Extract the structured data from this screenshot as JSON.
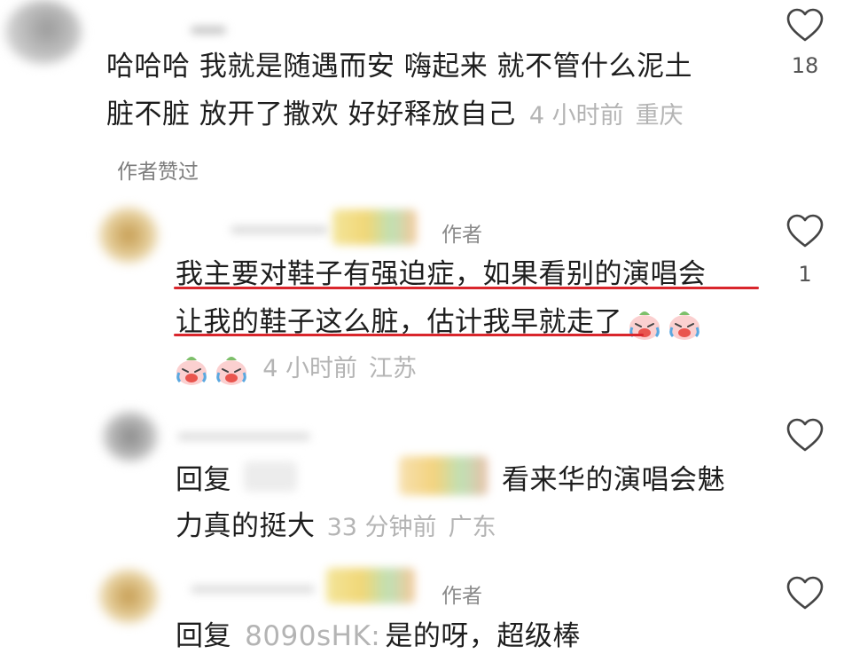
{
  "comments": [
    {
      "text_line1": "哈哈哈 我就是随遇而安 嗨起来 就不管什么泥土",
      "text_line2": "脏不脏 放开了撒欢 好好释放自己",
      "time": "4 小时前",
      "location": "重庆",
      "likes": "18",
      "liked_by": "作者赞过"
    },
    {
      "author_tag": "作者",
      "text_line1": "我主要对鞋子有强迫症，如果看别的演唱会",
      "text_line2": "让我的鞋子这么脏，估计我早就走了",
      "time": "4 小时前",
      "location": "江苏",
      "likes": "1",
      "highlight_color": "#d9262c"
    },
    {
      "reply_prefix": "回复",
      "text_line1": "看来华的演唱会魅",
      "text_line2": "力真的挺大",
      "time": "33 分钟前",
      "location": "广东"
    },
    {
      "author_tag": "作者",
      "reply_prefix": "回复",
      "reply_to": "8090sHK:",
      "text_line1": "是的呀，超级棒"
    }
  ],
  "icons": {
    "like": "heart-outline-icon",
    "emoji": "crying-laughing-emoji"
  }
}
